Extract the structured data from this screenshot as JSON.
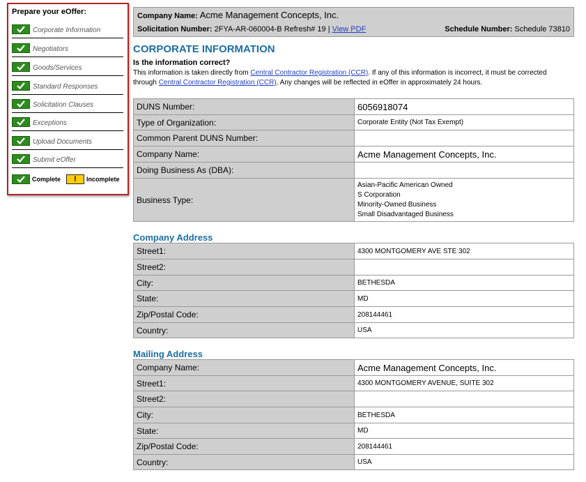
{
  "sidebar": {
    "title": "Prepare your eOffer:",
    "steps": [
      {
        "label": "Corporate Information"
      },
      {
        "label": "Negotiators"
      },
      {
        "label": "Goods/Services"
      },
      {
        "label": "Standard Responses"
      },
      {
        "label": "Solicitation Clauses"
      },
      {
        "label": "Exceptions"
      },
      {
        "label": "Upload Documents"
      },
      {
        "label": "Submit eOffer"
      }
    ],
    "legend": {
      "complete": "Complete",
      "incomplete": "Incomplete",
      "incomplete_symbol": "!"
    }
  },
  "header": {
    "company_label": "Company Name:",
    "company_value": "Acme Management Concepts, Inc.",
    "solicitation_label": "Solicitation Number:",
    "solicitation_value": "2FYA-AR-060004-B Refresh# 19",
    "separator": "|",
    "view_pdf": "View PDF",
    "schedule_label": "Schedule Number:",
    "schedule_value": "Schedule 73810"
  },
  "main": {
    "title": "CORPORATE INFORMATION",
    "question": "Is the information correct?",
    "info": {
      "p1": "This information is taken directly from ",
      "link1": "Central Contractor Registration (CCR)",
      "p2": ". If any of this information is incorrect, it must be corrected through ",
      "link2": "Central Contractor Registration (CCR)",
      "p3": ". Any changes will be reflected in eOffer in approximately 24 hours."
    }
  },
  "corporate": {
    "rows": [
      {
        "label": "DUNS Number:",
        "value": "6056918074"
      },
      {
        "label": "Type of Organization:",
        "value": "Corporate Entity (Not Tax Exempt)"
      },
      {
        "label": "Common Parent DUNS Number:",
        "value": ""
      },
      {
        "label": "Company Name:",
        "value": "Acme Management Concepts, Inc."
      },
      {
        "label": "Doing Business As (DBA):",
        "value": ""
      }
    ],
    "business_type_label": "Business Type:",
    "business_types": [
      "Asian-Pacific American Owned",
      "S Corporation",
      "Minority-Owned Business",
      "Small Disadvantaged Business"
    ]
  },
  "company_address": {
    "heading": "Company Address",
    "rows": [
      {
        "label": "Street1:",
        "value": "4300 MONTGOMERY AVE STE 302"
      },
      {
        "label": "Street2:",
        "value": ""
      },
      {
        "label": "City:",
        "value": "BETHESDA"
      },
      {
        "label": "State:",
        "value": "MD"
      },
      {
        "label": "Zip/Postal Code:",
        "value": "208144461"
      },
      {
        "label": "Country:",
        "value": "USA"
      }
    ]
  },
  "mailing_address": {
    "heading": "Mailing Address",
    "rows": [
      {
        "label": "Company Name:",
        "value": "Acme Management Concepts, Inc."
      },
      {
        "label": "Street1:",
        "value": "4300 MONTGOMERY AVENUE, SUITE 302"
      },
      {
        "label": "Street2:",
        "value": ""
      },
      {
        "label": "City:",
        "value": "BETHESDA"
      },
      {
        "label": "State:",
        "value": "MD"
      },
      {
        "label": "Zip/Postal Code:",
        "value": "208144461"
      },
      {
        "label": "Country:",
        "value": "USA"
      }
    ]
  },
  "colors": {
    "accent": "#1c6ea4",
    "sidebar_border": "#b22222",
    "complete": "#2e8b1e",
    "incomplete": "#ffcc00",
    "label_bg": "#cfcfcf"
  }
}
